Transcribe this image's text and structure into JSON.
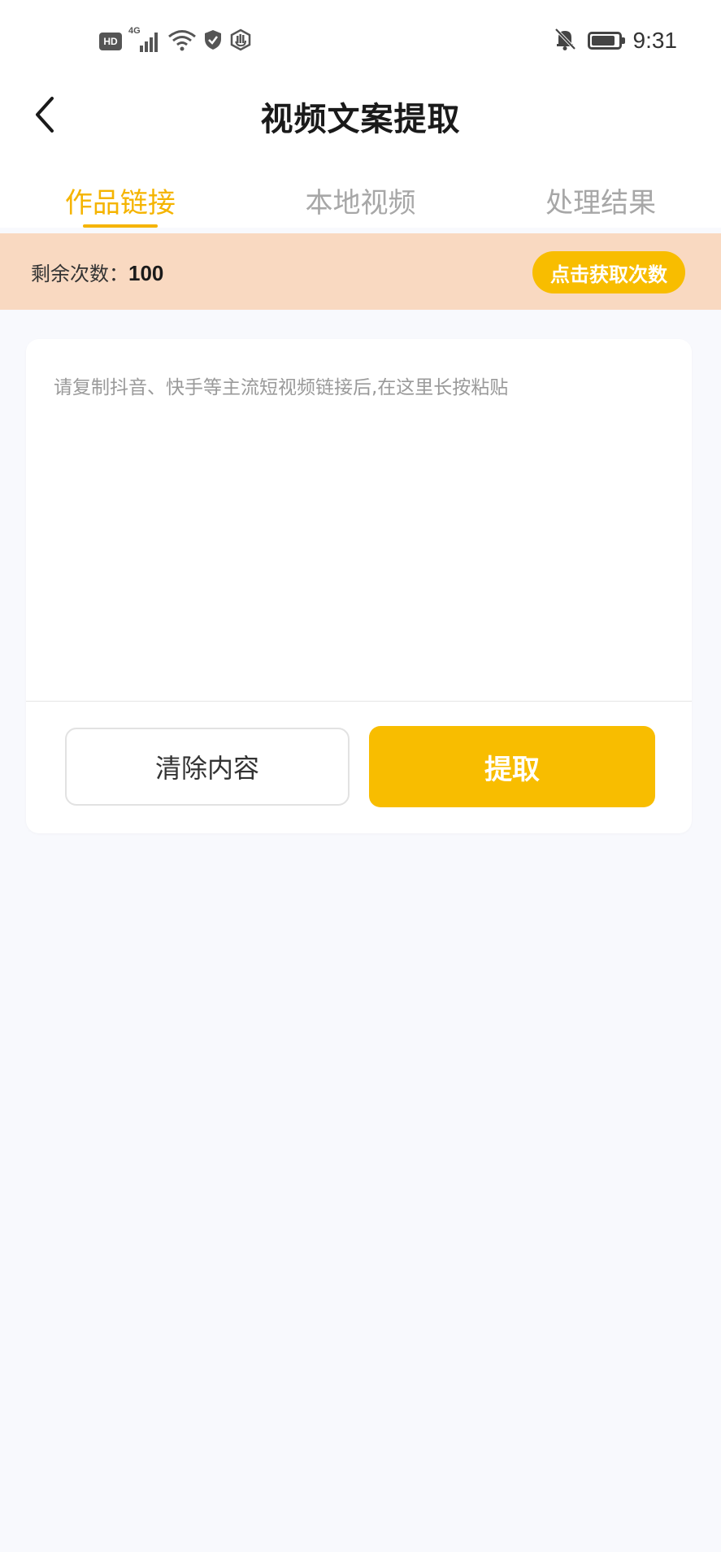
{
  "status_bar": {
    "hd": "HD",
    "network": "4G",
    "time": "9:31",
    "icons": [
      "hd-icon",
      "signal-icon",
      "wifi-icon",
      "shield-icon",
      "hand-icon",
      "bell-off-icon",
      "battery-icon"
    ]
  },
  "header": {
    "title": "视频文案提取",
    "back_icon": "chevron-left-icon"
  },
  "tabs": [
    {
      "label": "作品链接",
      "active": true
    },
    {
      "label": "本地视频",
      "active": false
    },
    {
      "label": "处理结果",
      "active": false
    }
  ],
  "remain": {
    "label": "剩余次数：",
    "count": "100",
    "get_button": "点击获取次数"
  },
  "input": {
    "value": "",
    "placeholder": "请复制抖音、快手等主流短视频链接后,在这里长按粘贴"
  },
  "actions": {
    "clear_label": "清除内容",
    "extract_label": "提取"
  },
  "colors": {
    "accent": "#f8bd00",
    "tab_active": "#f5b400",
    "banner_bg": "#f9d9c1",
    "page_bg": "#f8f9fd"
  }
}
